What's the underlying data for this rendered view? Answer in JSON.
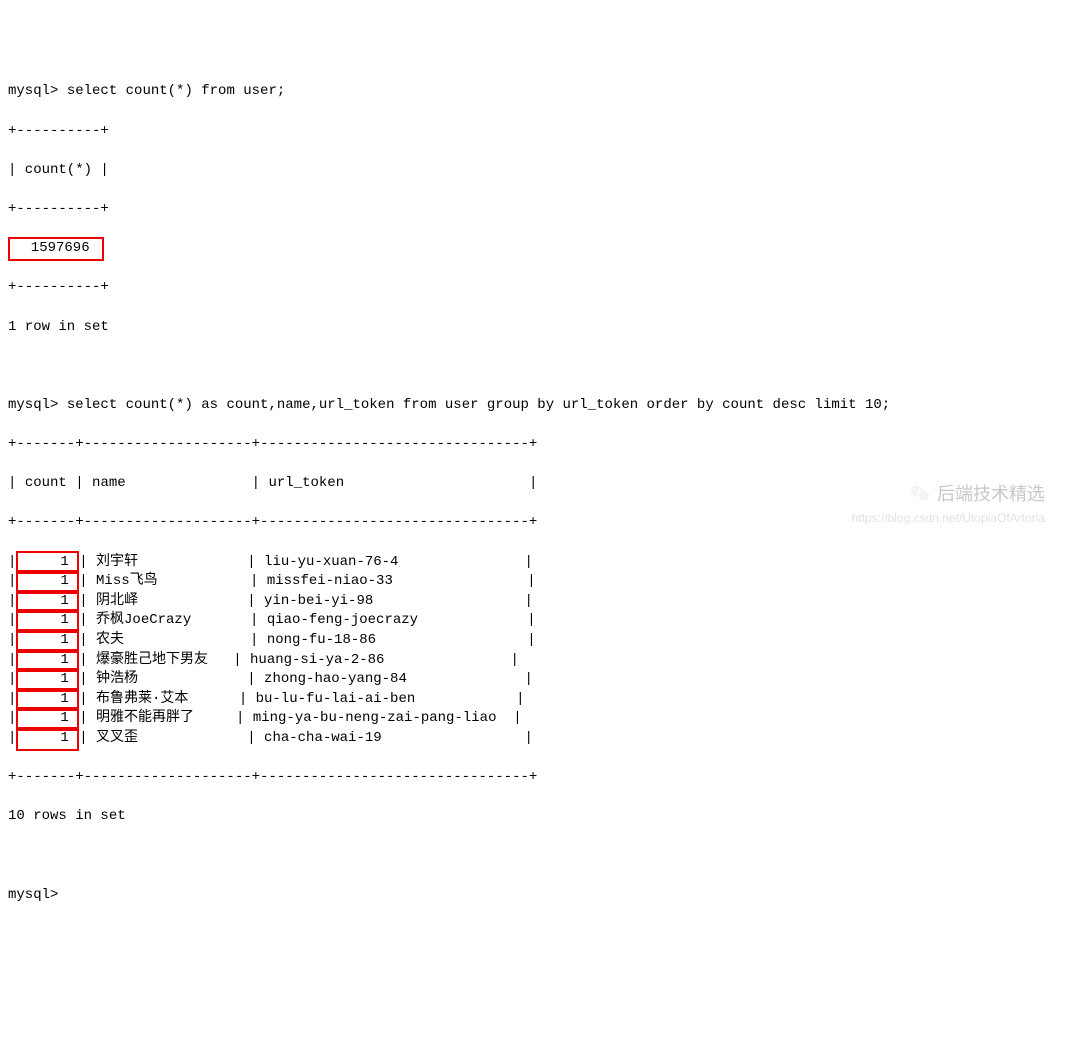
{
  "prompt": "mysql>",
  "query1": "select count(*) from user;",
  "border1": {
    "top": "+----------+",
    "bottom": "+----------+"
  },
  "header1": "| count(*) |",
  "count_value": "  1597696 ",
  "rows_in_set_1": "1 row in set",
  "query2": "select count(*) as count,name,url_token from user group by url_token order by count desc limit 10;",
  "border2": {
    "top": "+-------+--------------------+--------------------------------+",
    "mid": "+-------+--------------------+--------------------------------+",
    "bottom": "+-------+--------------------+--------------------------------+"
  },
  "columns": {
    "count": "count",
    "name": "name",
    "url_token": "url_token"
  },
  "chart_data": {
    "type": "table",
    "columns": [
      "count",
      "name",
      "url_token"
    ],
    "rows": [
      {
        "count": "1",
        "name": "刘宇轩",
        "url_token": "liu-yu-xuan-76-4"
      },
      {
        "count": "1",
        "name": "Miss飞鸟",
        "url_token": "missfei-niao-33"
      },
      {
        "count": "1",
        "name": "阴北峄",
        "url_token": "yin-bei-yi-98"
      },
      {
        "count": "1",
        "name": "乔枫JoeCrazy",
        "url_token": "qiao-feng-joecrazy"
      },
      {
        "count": "1",
        "name": "农夫",
        "url_token": "nong-fu-18-86"
      },
      {
        "count": "1",
        "name": "爆豪胜己地下男友",
        "url_token": "huang-si-ya-2-86"
      },
      {
        "count": "1",
        "name": "钟浩杨",
        "url_token": "zhong-hao-yang-84"
      },
      {
        "count": "1",
        "name": "布鲁弗莱·艾本",
        "url_token": "bu-lu-fu-lai-ai-ben"
      },
      {
        "count": "1",
        "name": "明雅不能再胖了",
        "url_token": "ming-ya-bu-neng-zai-pang-liao"
      },
      {
        "count": "1",
        "name": "叉叉歪",
        "url_token": "cha-cha-wai-19"
      }
    ]
  },
  "rows_in_set_2": "10 rows in set",
  "watermark_text": "后端技术精选",
  "blog_watermark": "https://blog.csdn.net/UtopiaOfArtoria"
}
